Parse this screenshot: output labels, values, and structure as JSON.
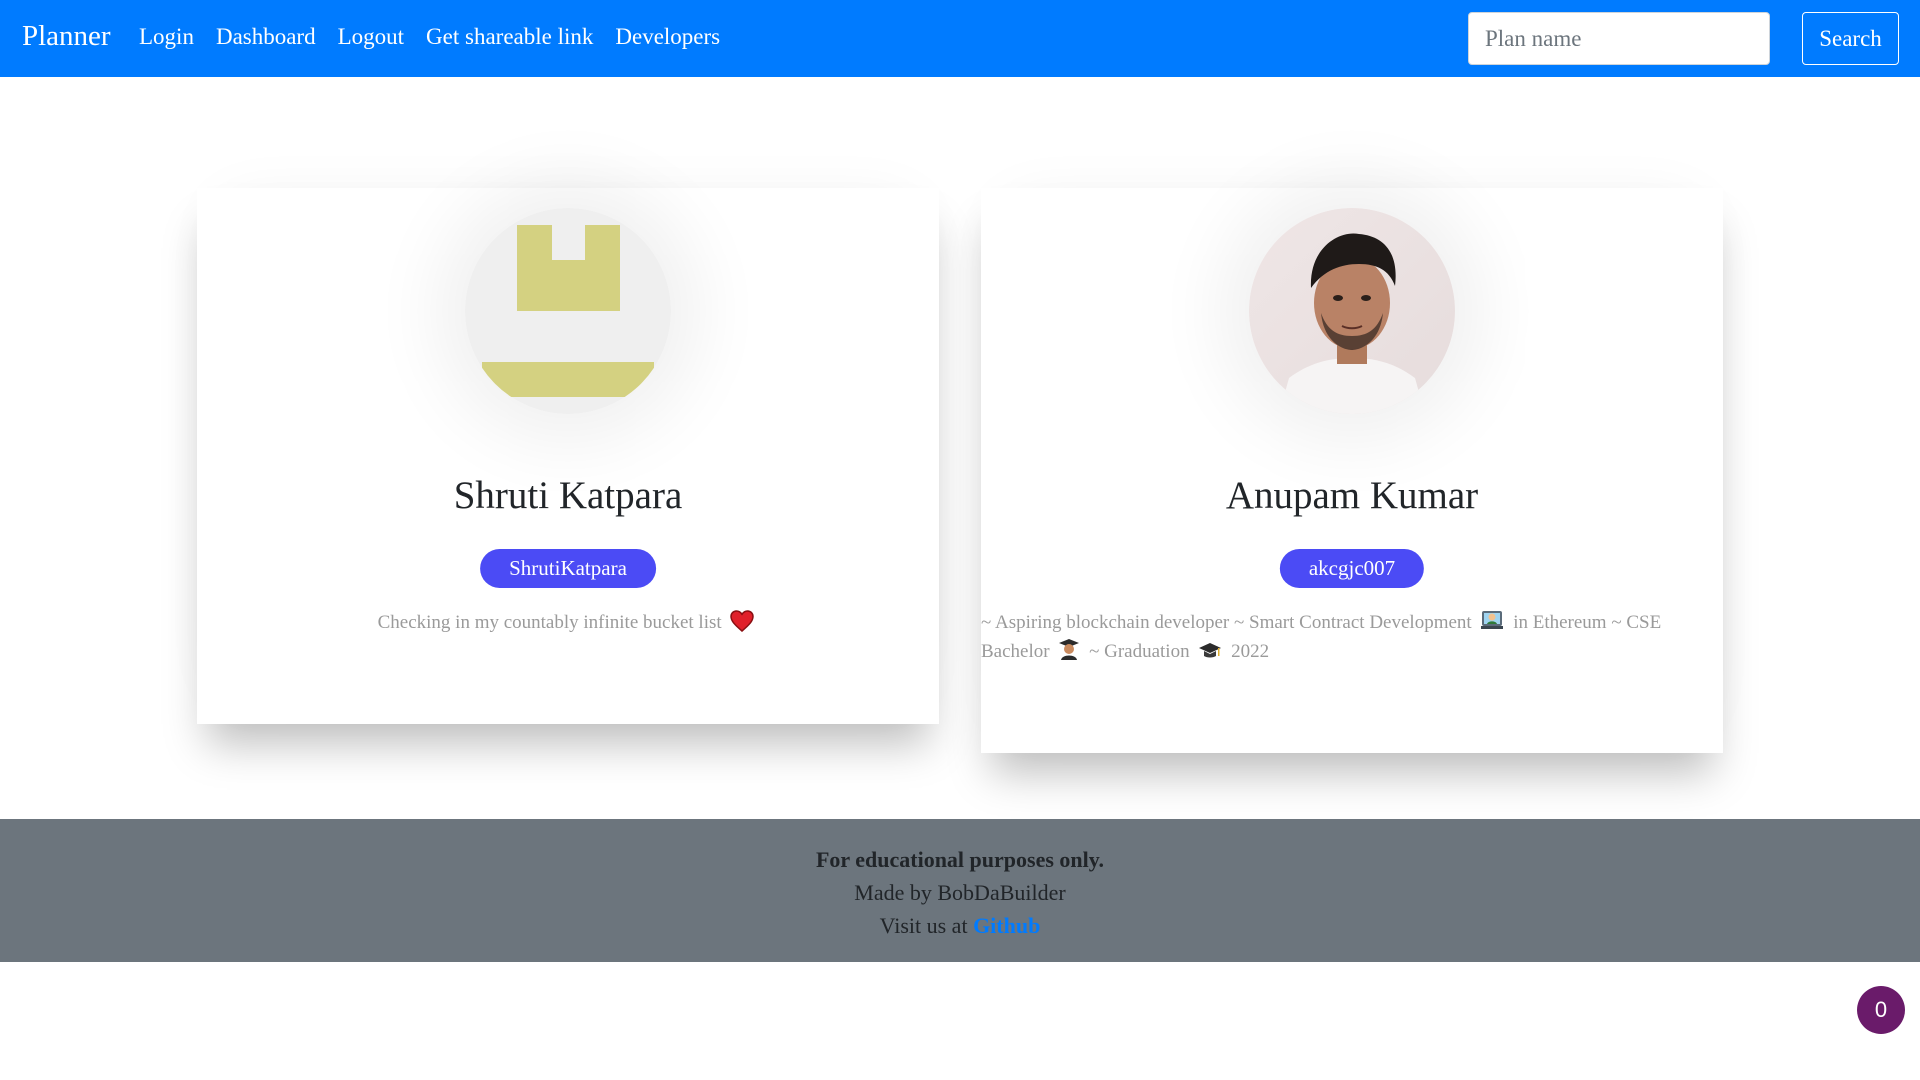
{
  "navbar": {
    "brand": "Planner",
    "links": [
      {
        "label": "Login"
      },
      {
        "label": "Dashboard"
      },
      {
        "label": "Logout"
      },
      {
        "label": "Get shareable link"
      },
      {
        "label": "Developers"
      }
    ],
    "search": {
      "placeholder": "Plan name",
      "value": "",
      "button_label": "Search"
    },
    "color": "#007bff"
  },
  "developers": [
    {
      "name": "Shruti Katpara",
      "username": "ShrutiKatpara",
      "bio_text": "Checking in my countably infinite bucket list",
      "bio_icon": "red-heart-icon",
      "avatar": "identicon-avatar-icon"
    },
    {
      "name": "Anupam Kumar",
      "username": "akcgjc007",
      "bio_part1": "~ Aspiring blockchain developer ~ Smart Contract Development",
      "bio_icon1": "technologist-icon",
      "bio_part2": "in Ethereum ~ CSE Bachelor",
      "bio_icon2": "student-icon",
      "bio_part3": "~ Graduation",
      "bio_icon3": "graduation-cap-icon",
      "bio_part4": "2022",
      "avatar": "profile-photo"
    }
  ],
  "footer": {
    "line1": "For educational purposes only.",
    "line2": "Made by BobDaBuilder",
    "line3_prefix": "Visit us at",
    "line3_link": "Github",
    "background": "#6c757d"
  },
  "float_badge": {
    "count": "0"
  },
  "colors": {
    "badge": "#4b4bf5",
    "identicon": "#d4d181"
  }
}
